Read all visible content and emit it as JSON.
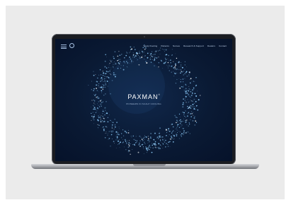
{
  "website": {
    "brand": "PAXMAN",
    "brand_mark": "®",
    "tagline": "PIONEERS IN SCALP COOLING",
    "nav_items": [
      "Scalp Cooling",
      "Patients",
      "Nurses",
      "Research & Support",
      "Dealers",
      "Contact"
    ]
  },
  "colors": {
    "background": "#ebebeb",
    "screen": "#0a1a34",
    "particles": "#8fd0ff"
  },
  "icons": [
    "menu-icon",
    "logo-ring-icon"
  ]
}
